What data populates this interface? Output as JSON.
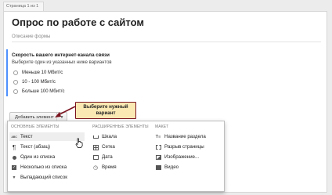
{
  "page_tab": "Страница 1 из 1",
  "form": {
    "title": "Опрос по работе с сайтом",
    "description_placeholder": "Описание формы"
  },
  "question": {
    "title": "Скорость вашего интернет-канала связи",
    "help": "Выберите один из указанных ниже вариантов",
    "options": [
      "Меньше 10 Мбит/с",
      "10 - 100 Мбит/с",
      "Больше 100 Мбит/с"
    ]
  },
  "toolbar": {
    "add_element_label": "Добавить элемент"
  },
  "callout": {
    "line1": "Выберите нужный",
    "line2": "вариант"
  },
  "menu": {
    "columns": [
      {
        "header": "ОСНОВНЫЕ ЭЛЕМЕНТЫ",
        "items": [
          {
            "label": "Текст",
            "icon": "text-abc-icon",
            "highlighted": true
          },
          {
            "label": "Текст (абзац)",
            "icon": "paragraph-icon"
          },
          {
            "label": "Один из списка",
            "icon": "radio-icon"
          },
          {
            "label": "Несколько из списка",
            "icon": "checkbox-icon"
          },
          {
            "label": "Выпадающий список",
            "icon": "dropdown-icon"
          }
        ]
      },
      {
        "header": "РАСШИРЕННЫЕ ЭЛЕМЕНТЫ",
        "items": [
          {
            "label": "Шкала",
            "icon": "scale-icon"
          },
          {
            "label": "Сетка",
            "icon": "grid-icon"
          },
          {
            "label": "Дата",
            "icon": "calendar-icon"
          },
          {
            "label": "Время",
            "icon": "clock-icon"
          }
        ]
      },
      {
        "header": "МАКЕТ",
        "items": [
          {
            "label": "Название раздела",
            "icon": "section-title-icon"
          },
          {
            "label": "Разрыв страницы",
            "icon": "page-break-icon"
          },
          {
            "label": "Изображение...",
            "icon": "image-icon"
          },
          {
            "label": "Видео",
            "icon": "video-icon"
          }
        ]
      }
    ]
  },
  "colors": {
    "accent": "#4d90fe",
    "callout_bg": "#fbe9b4",
    "callout_border": "#7a1420"
  }
}
